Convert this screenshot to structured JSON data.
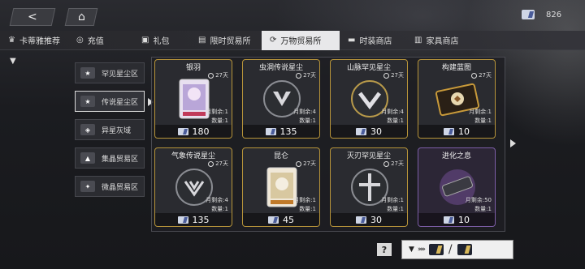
{
  "top": {
    "back_label": "<",
    "home_label": "⌂",
    "currency_value": "826"
  },
  "tabs": [
    {
      "label": "卡蒂雅推荐",
      "icon": "agent-icon"
    },
    {
      "label": "充值",
      "icon": "coin-icon"
    },
    {
      "label": "礼包",
      "icon": "gift-icon"
    },
    {
      "label": "限时贸易所",
      "icon": "clock-trade-icon"
    },
    {
      "label": "万物贸易所",
      "icon": "trade-icon",
      "active": true
    },
    {
      "label": "时装商店",
      "icon": "outfit-icon"
    },
    {
      "label": "家具商店",
      "icon": "furniture-icon"
    }
  ],
  "sidebar": [
    {
      "label": "罕见星尘区",
      "icon": "rare-stardust-icon"
    },
    {
      "label": "传说星尘区",
      "icon": "legend-stardust-icon",
      "active": true
    },
    {
      "label": "异星灰域",
      "icon": "gray-zone-icon"
    },
    {
      "label": "集晶贸易区",
      "icon": "crystal-icon"
    },
    {
      "label": "微晶贸易区",
      "icon": "micro-crystal-icon"
    }
  ],
  "cards": [
    {
      "name": "银羽",
      "timer": "27天",
      "remain": "月剩余:1",
      "qty": "数量:1",
      "price": "180",
      "style": "gold"
    },
    {
      "name": "虫洞传说星尘",
      "timer": "27天",
      "remain": "月剩余:4",
      "qty": "数量:1",
      "price": "135",
      "style": "gold"
    },
    {
      "name": "山脉罕见星尘",
      "timer": "27天",
      "remain": "月剩余:4",
      "qty": "数量:1",
      "price": "30",
      "style": "gold"
    },
    {
      "name": "构建蓝图",
      "timer": "27天",
      "remain": "月剩余:1",
      "qty": "数量:1",
      "price": "10",
      "style": "gold"
    },
    {
      "name": "气象传说星尘",
      "timer": "27天",
      "remain": "月剩余:4",
      "qty": "数量:1",
      "price": "135",
      "style": "gold"
    },
    {
      "name": "昆仑",
      "timer": "27天",
      "remain": "月剩余:1",
      "qty": "数量:1",
      "price": "45",
      "style": "gold"
    },
    {
      "name": "灭刃罕见星尘",
      "timer": "27天",
      "remain": "月剩余:1",
      "qty": "数量:1",
      "price": "30",
      "style": "gold"
    },
    {
      "name": "进化之息",
      "timer": "",
      "remain": "月剩余:50",
      "qty": "数量:1",
      "price": "10",
      "style": "purple"
    }
  ],
  "bottom": {
    "help_label": "?",
    "exchange_chevrons": "›››››"
  }
}
